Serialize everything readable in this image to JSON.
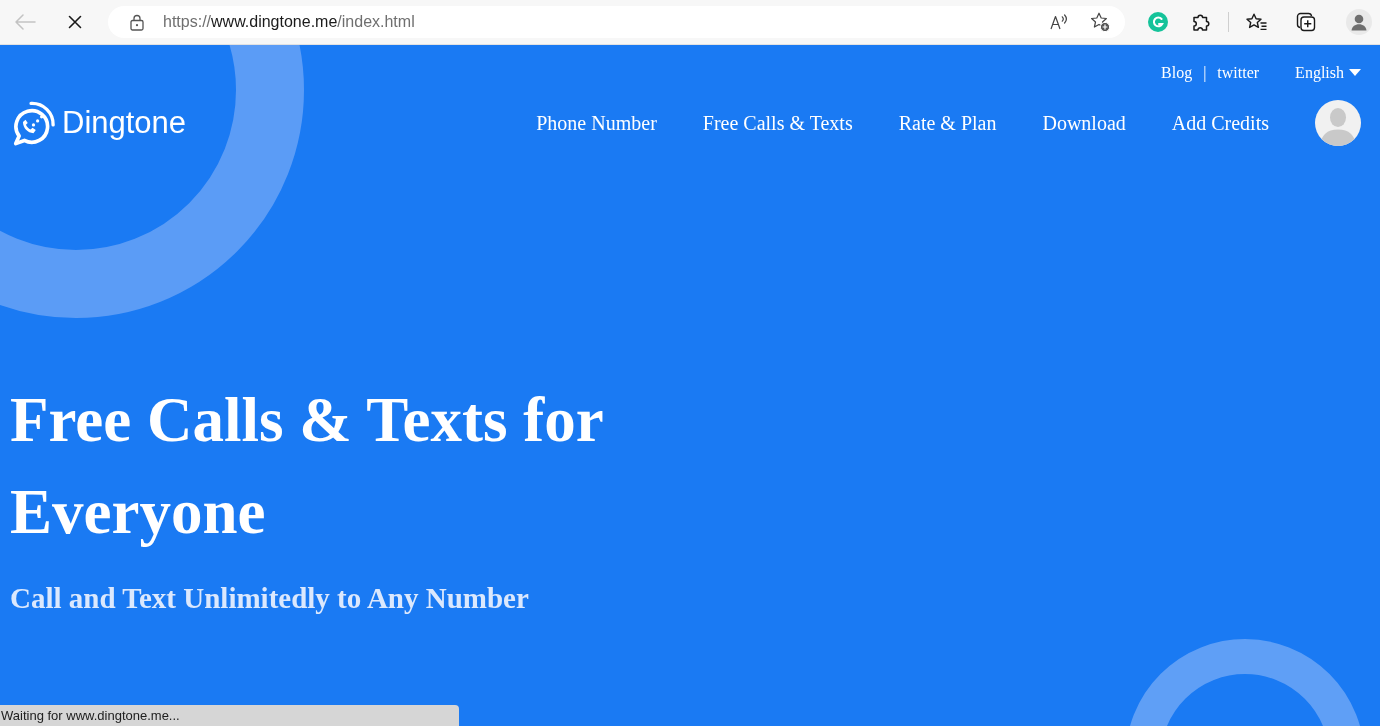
{
  "browser": {
    "back_disabled": true,
    "loading": true,
    "url": {
      "scheme": "https://",
      "host": "www.dingtone.me",
      "path": "/index.html"
    }
  },
  "header": {
    "logo": {
      "text": "Dingtone"
    },
    "top_links": [
      {
        "label": "Blog"
      },
      {
        "label": "twitter"
      }
    ],
    "separator": "|",
    "language": {
      "label": "English"
    },
    "nav": [
      {
        "label": "Phone Number"
      },
      {
        "label": "Free Calls & Texts"
      },
      {
        "label": "Rate & Plan"
      },
      {
        "label": "Download"
      },
      {
        "label": "Add Credits"
      }
    ]
  },
  "hero": {
    "title": "Free Calls & Texts for Everyone",
    "subtitle": "Call and Text Unlimitedly to Any Number"
  },
  "status_bar": {
    "text": "Waiting for www.dingtone.me..."
  }
}
